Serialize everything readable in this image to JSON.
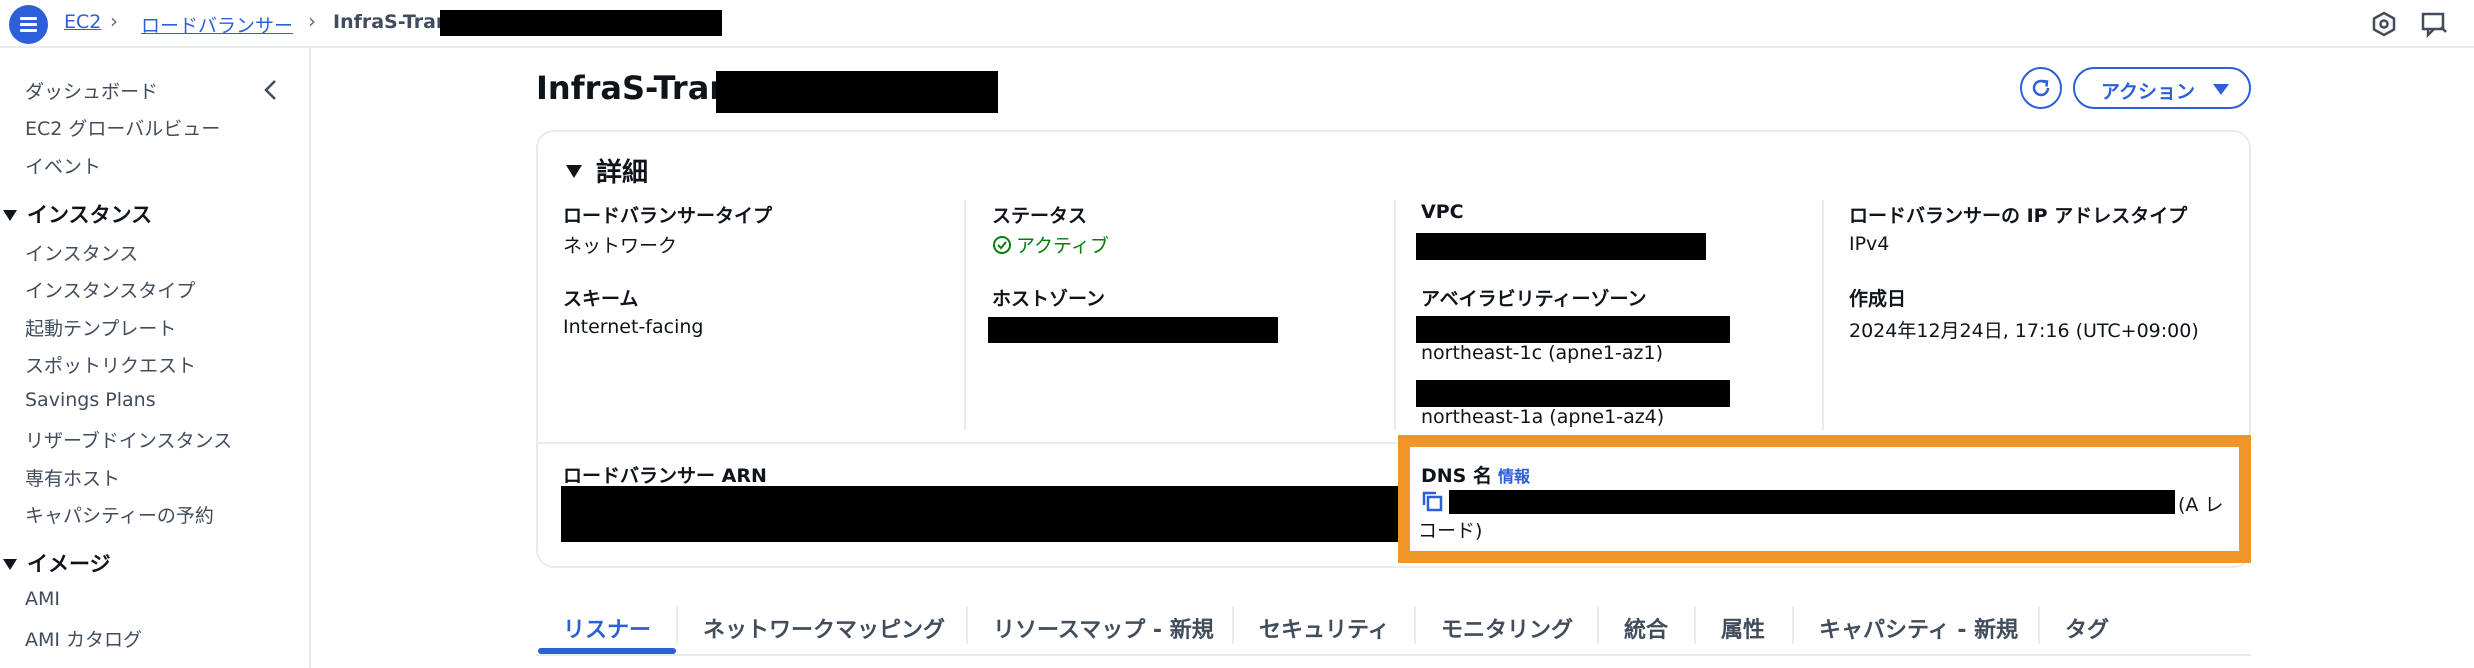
{
  "header": {
    "breadcrumbs": [
      "EC2",
      "ロードバランサー",
      "InfraS-Trans"
    ]
  },
  "sidebar": {
    "top_items": [
      "ダッシュボード",
      "EC2 グローバルビュー",
      "イベント"
    ],
    "sections": [
      {
        "title": "インスタンス",
        "items": [
          "インスタンス",
          "インスタンスタイプ",
          "起動テンプレート",
          "スポットリクエスト",
          "Savings Plans",
          "リザーブドインスタンス",
          "専有ホスト",
          "キャパシティーの予約"
        ]
      },
      {
        "title": "イメージ",
        "items": [
          "AMI",
          "AMI カタログ"
        ]
      }
    ]
  },
  "page": {
    "title": "InfraS-Trans",
    "action_button": "アクション"
  },
  "details": {
    "heading": "詳細",
    "lb_type_label": "ロードバランサータイプ",
    "lb_type_value": "ネットワーク",
    "scheme_label": "スキーム",
    "scheme_value": "Internet-facing",
    "status_label": "ステータス",
    "status_value": "アクティブ",
    "hosted_zone_label": "ホストゾーン",
    "vpc_label": "VPC",
    "az_label": "アベイラビリティーゾーン",
    "az_values": [
      "northeast-1c (apne1-az1)",
      "northeast-1a (apne1-az4)"
    ],
    "ip_type_label": "ロードバランサーの IP アドレスタイプ",
    "ip_type_value": "IPv4",
    "created_label": "作成日",
    "created_value": "2024年12月24日, 17:16 (UTC+09:00)",
    "arn_label": "ロードバランサー ARN",
    "dns_label": "DNS 名",
    "dns_info": "情報",
    "dns_suffix_1": "(A レ",
    "dns_suffix_2": "コード)"
  },
  "tabs": [
    "リスナー",
    "ネットワークマッピング",
    "リソースマップ - 新規",
    "セキュリティ",
    "モニタリング",
    "統合",
    "属性",
    "キャパシティ - 新規",
    "タグ"
  ],
  "colors": {
    "accent": "#2c5fd8",
    "success": "#037f0c",
    "highlight": "#f0952a"
  }
}
